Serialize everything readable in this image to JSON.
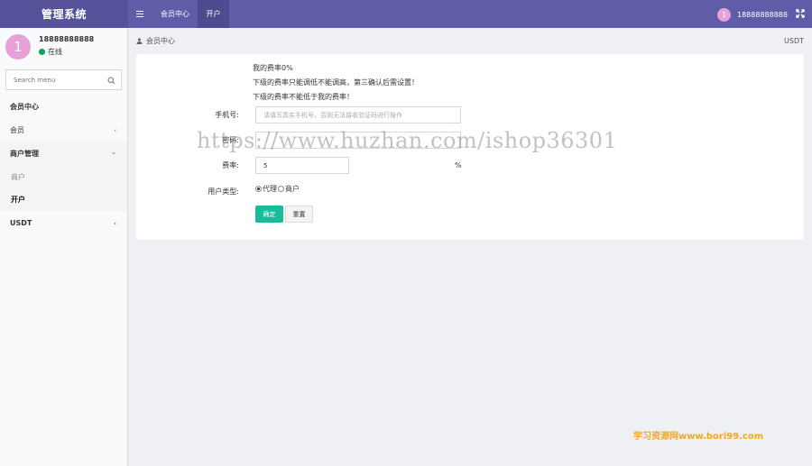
{
  "app": {
    "title": "管理系统"
  },
  "header": {
    "tabs": [
      {
        "label": "会员中心"
      },
      {
        "label": "开户"
      }
    ],
    "username": "18888888888",
    "avatar_initial": "1"
  },
  "sidebar": {
    "profile": {
      "name": "18888888888",
      "status": "在线",
      "avatar_initial": "1"
    },
    "search_placeholder": "Search menu",
    "items": [
      {
        "label": "会员中心"
      },
      {
        "label": "会员"
      },
      {
        "label": "商户管理"
      },
      {
        "label": "商户"
      },
      {
        "label": "开户"
      },
      {
        "label": "USDT"
      }
    ]
  },
  "breadcrumb": {
    "label": "会员中心"
  },
  "right_label": "USDT",
  "form": {
    "info_lines": [
      "我的费率0%",
      "下级的费率只能调低不能调高，第三确认后需设置！",
      "下级的费率不能低于我的费率！"
    ],
    "phone": {
      "label": "手机号:",
      "placeholder": "请填写真实手机号，否则无法接收验证码进行操作"
    },
    "password": {
      "label": "密码:",
      "value": ""
    },
    "rate": {
      "label": "费率:",
      "value": "5",
      "unit": "%"
    },
    "user_type": {
      "label": "用户类型:",
      "options": [
        "代理",
        "商户"
      ],
      "selected": "代理"
    },
    "submit_label": "确定",
    "reset_label": "重置"
  },
  "watermarks": {
    "main": "https://www.huzhan.com/ishop36301",
    "corner": "学习资源网www.bori99.com"
  },
  "colors": {
    "topbar": "#605ca8",
    "logo_bg": "#555299",
    "accent": "#18bc9c",
    "avatar": "#e8a0d8",
    "online": "#00a65a"
  }
}
